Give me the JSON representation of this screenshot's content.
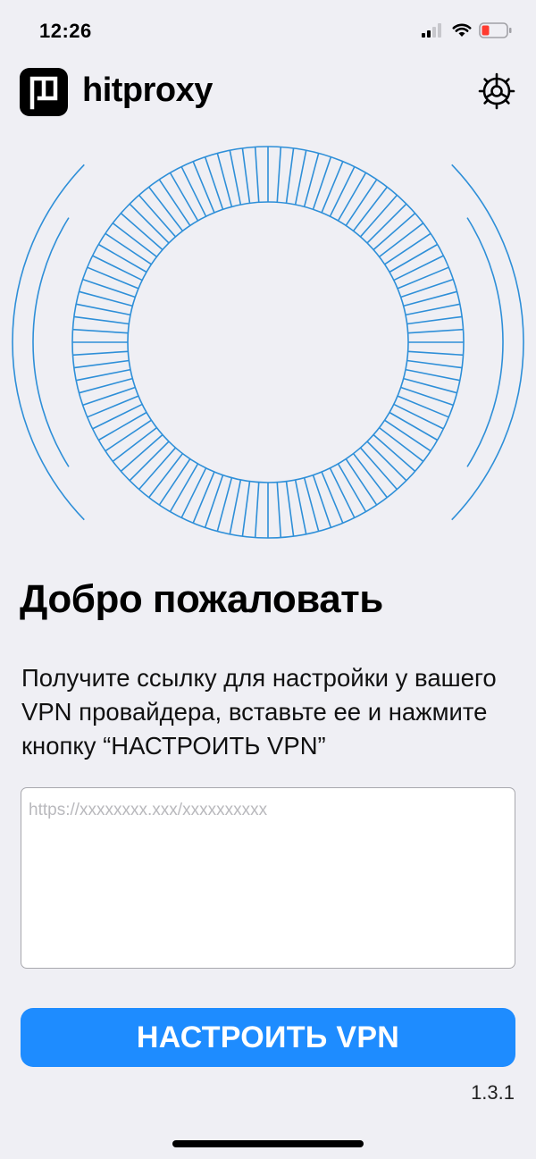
{
  "status_bar": {
    "time": "12:26",
    "icons": [
      "cellular-signal-icon",
      "wifi-icon",
      "battery-low-icon"
    ],
    "battery_color": "#ff3b30"
  },
  "header": {
    "app_name": "hitproxy",
    "logo_icon": "hitproxy-logo-icon",
    "settings_icon": "gear-icon"
  },
  "illustration": {
    "icon": "globe-rings-icon",
    "accent_color": "#2e8fd8"
  },
  "welcome": {
    "title": "Добро пожаловать",
    "instructions": "Получите ссылку для настройки у вашего VPN провайдера, вставьте ее и нажмите кнопку “НАСТРОИТЬ VPN”"
  },
  "url_input": {
    "value": "",
    "placeholder": "https://xxxxxxxx.xxx/xxxxxxxxxx"
  },
  "setup_button": {
    "label": "НАСТРОИТЬ VPN",
    "color": "#1e8cff"
  },
  "version": "1.3.1"
}
